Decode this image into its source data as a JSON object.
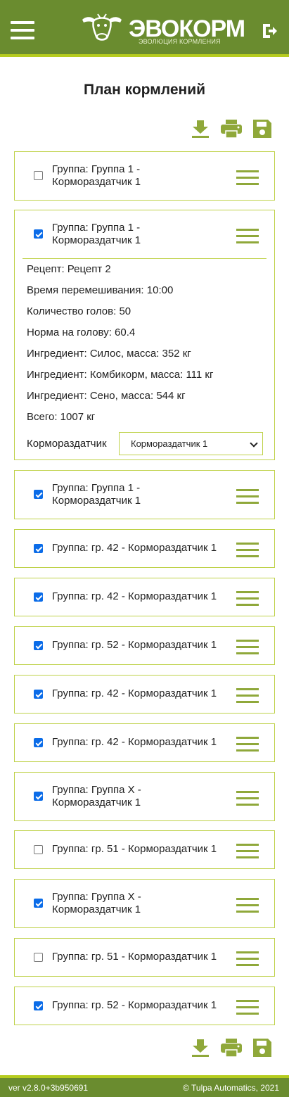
{
  "header": {
    "logo_main": "ЭВО",
    "logo_accent": "КОРМ",
    "logo_sub": "ЭВОЛЮЦИЯ КОРМЛЕНИЯ"
  },
  "page": {
    "title": "План кормлений"
  },
  "colors": {
    "brand": "#6a8c2f",
    "accent": "#b6cc1f",
    "icon": "#8fa83a",
    "checkbox": "#0b6ce8"
  },
  "toolbar_icons": [
    "download-icon",
    "print-icon",
    "save-icon"
  ],
  "plans": [
    {
      "label_1": "Группа: Группа 1 -",
      "label_2": "Кормораздатчик 1",
      "checked": false
    },
    {
      "label_1": "Группа: Группа 1 -",
      "label_2": "Кормораздатчик 1",
      "checked": true,
      "details": {
        "recipe": "Рецепт: Рецепт 2",
        "mix_time": "Время перемешивания: 10:00",
        "heads": "Количество голов: 50",
        "norm": "Норма на голову: 60.4",
        "ingredient_1": "Ингредиент: Силос, масса: 352 кг",
        "ingredient_2": "Ингредиент: Комбикорм, масса: 111 кг",
        "ingredient_3": "Ингредиент: Сено, масса: 544 кг",
        "total": "Всего: 1007 кг",
        "feeder_label": "Кормораздатчик",
        "feeder_value": "Кормораздатчик 1"
      }
    },
    {
      "label_1": "Группа: Группа 1 -",
      "label_2": "Кормораздатчик 1",
      "checked": true
    },
    {
      "label": "Группа: гр. 42 - Кормораздатчик 1",
      "checked": true
    },
    {
      "label": "Группа: гр. 42 - Кормораздатчик 1",
      "checked": true
    },
    {
      "label": "Группа: гр. 52 - Кормораздатчик 1",
      "checked": true
    },
    {
      "label": "Группа: гр. 42 - Кормораздатчик 1",
      "checked": true
    },
    {
      "label": "Группа: гр. 42 - Кормораздатчик 1",
      "checked": true
    },
    {
      "label_1": "Группа: Группа X -",
      "label_2": "Кормораздатчик 1",
      "checked": true
    },
    {
      "label": "Группа: гр. 51 - Кормораздатчик 1",
      "checked": false
    },
    {
      "label_1": "Группа: Группа X -",
      "label_2": "Кормораздатчик 1",
      "checked": true
    },
    {
      "label": "Группа: гр. 51 - Кормораздатчик 1",
      "checked": false
    },
    {
      "label": "Группа: гр. 52 - Кормораздатчик 1",
      "checked": true
    }
  ],
  "footer": {
    "version": "ver v2.8.0+3b950691",
    "copyright": "© Tulpa Automatics, 2021"
  }
}
